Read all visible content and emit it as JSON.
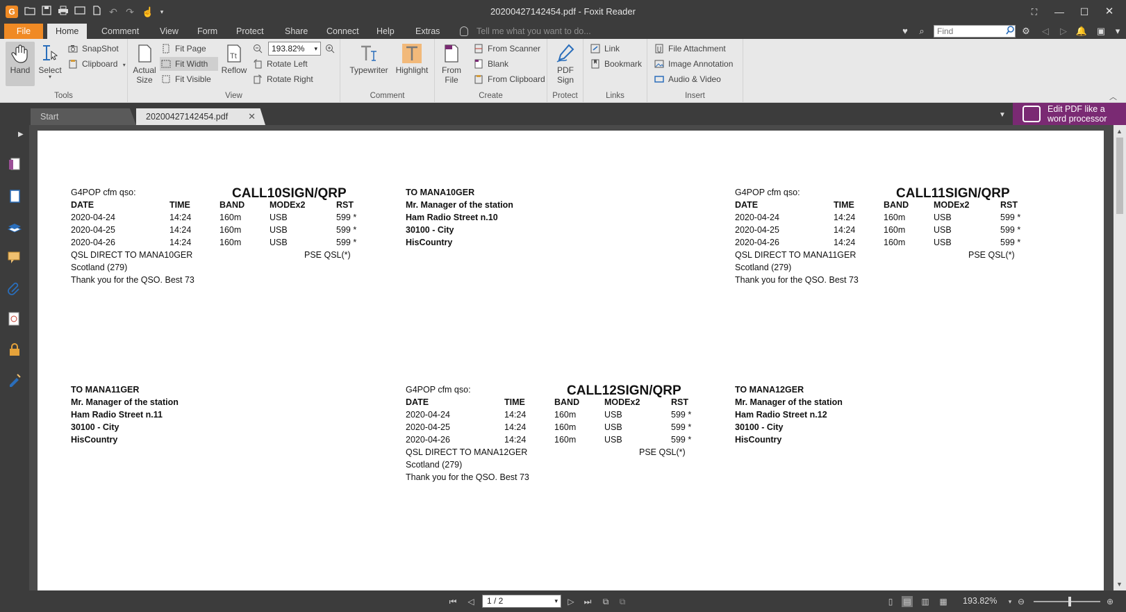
{
  "window": {
    "title": "20200427142454.pdf - Foxit Reader"
  },
  "menu": {
    "file": "File",
    "tabs": [
      "Home",
      "Comment",
      "View",
      "Form",
      "Protect",
      "Share",
      "Connect",
      "Help",
      "Extras"
    ],
    "active_tab": "Home",
    "tell_me_placeholder": "Tell me what you want to do...",
    "find_placeholder": "Find"
  },
  "ribbon": {
    "tools": {
      "label": "Tools",
      "hand": "Hand",
      "select": "Select",
      "snapshot": "SnapShot",
      "clipboard": "Clipboard"
    },
    "view": {
      "label": "View",
      "actual_size_1": "Actual",
      "actual_size_2": "Size",
      "fit_page": "Fit Page",
      "fit_width": "Fit Width",
      "fit_visible": "Fit Visible",
      "reflow": "Reflow",
      "zoom_value": "193.82%",
      "rotate_left": "Rotate Left",
      "rotate_right": "Rotate Right"
    },
    "comment": {
      "label": "Comment",
      "typewriter": "Typewriter",
      "highlight": "Highlight"
    },
    "create": {
      "label": "Create",
      "from_file_1": "From",
      "from_file_2": "File",
      "from_scanner": "From Scanner",
      "blank": "Blank",
      "from_clipboard": "From Clipboard"
    },
    "protect": {
      "label": "Protect",
      "pdf_sign_1": "PDF",
      "pdf_sign_2": "Sign"
    },
    "links": {
      "label": "Links",
      "link": "Link",
      "bookmark": "Bookmark"
    },
    "insert": {
      "label": "Insert",
      "file_attachment": "File Attachment",
      "image_annotation": "Image Annotation",
      "audio_video": "Audio & Video"
    }
  },
  "doc_tabs": {
    "start": "Start",
    "document": "20200427142454.pdf",
    "promo_line1": "Edit PDF like a",
    "promo_line2": "word processor"
  },
  "page": {
    "cards": [
      {
        "header": "G4POP cfm qso:",
        "callsign": "CALL10SIGN/QRP",
        "columns": [
          "DATE",
          "TIME",
          "BAND",
          "MODEx2",
          "RST"
        ],
        "rows": [
          [
            "2020-04-24",
            "14:24",
            "160m",
            "USB",
            "599 *"
          ],
          [
            "2020-04-25",
            "14:24",
            "160m",
            "USB",
            "599 *"
          ],
          [
            "2020-04-26",
            "14:24",
            "160m",
            "USB",
            "599 *"
          ]
        ],
        "direct": "QSL DIRECT TO MANA10GER",
        "pse": "PSE QSL(*)",
        "region": "Scotland (279)",
        "thanks": "Thank you for the QSO. Best 73"
      },
      {
        "header": "G4POP cfm qso:",
        "callsign": "CALL11SIGN/QRP",
        "columns": [
          "DATE",
          "TIME",
          "BAND",
          "MODEx2",
          "RST"
        ],
        "rows": [
          [
            "2020-04-24",
            "14:24",
            "160m",
            "USB",
            "599 *"
          ],
          [
            "2020-04-25",
            "14:24",
            "160m",
            "USB",
            "599 *"
          ],
          [
            "2020-04-26",
            "14:24",
            "160m",
            "USB",
            "599 *"
          ]
        ],
        "direct": "QSL DIRECT TO MANA11GER",
        "pse": "PSE QSL(*)",
        "region": "Scotland (279)",
        "thanks": "Thank you for the QSO. Best 73"
      },
      {
        "header": "G4POP cfm qso:",
        "callsign": "CALL12SIGN/QRP",
        "columns": [
          "DATE",
          "TIME",
          "BAND",
          "MODEx2",
          "RST"
        ],
        "rows": [
          [
            "2020-04-24",
            "14:24",
            "160m",
            "USB",
            "599 *"
          ],
          [
            "2020-04-25",
            "14:24",
            "160m",
            "USB",
            "599 *"
          ],
          [
            "2020-04-26",
            "14:24",
            "160m",
            "USB",
            "599 *"
          ]
        ],
        "direct": "QSL DIRECT TO MANA12GER",
        "pse": "PSE QSL(*)",
        "region": "Scotland (279)",
        "thanks": "Thank you for the QSO. Best 73"
      }
    ],
    "addresses": [
      {
        "to": "TO MANA10GER",
        "name": "Mr. Manager of the station",
        "street": "Ham Radio Street n.10",
        "city": "30100 - City",
        "country": "HisCountry"
      },
      {
        "to": "TO MANA11GER",
        "name": "Mr. Manager of the station",
        "street": "Ham Radio Street n.11",
        "city": "30100 - City",
        "country": "HisCountry"
      },
      {
        "to": "TO MANA12GER",
        "name": "Mr. Manager of the station",
        "street": "Ham Radio Street n.12",
        "city": "30100 - City",
        "country": "HisCountry"
      }
    ]
  },
  "status": {
    "page_indicator": "1 / 2",
    "zoom": "193.82%"
  },
  "colors": {
    "accent_orange": "#f08a24",
    "promo_purple": "#7a2a73",
    "chrome_dark": "#3c3c3c",
    "ribbon_bg": "#e8e8e8"
  }
}
